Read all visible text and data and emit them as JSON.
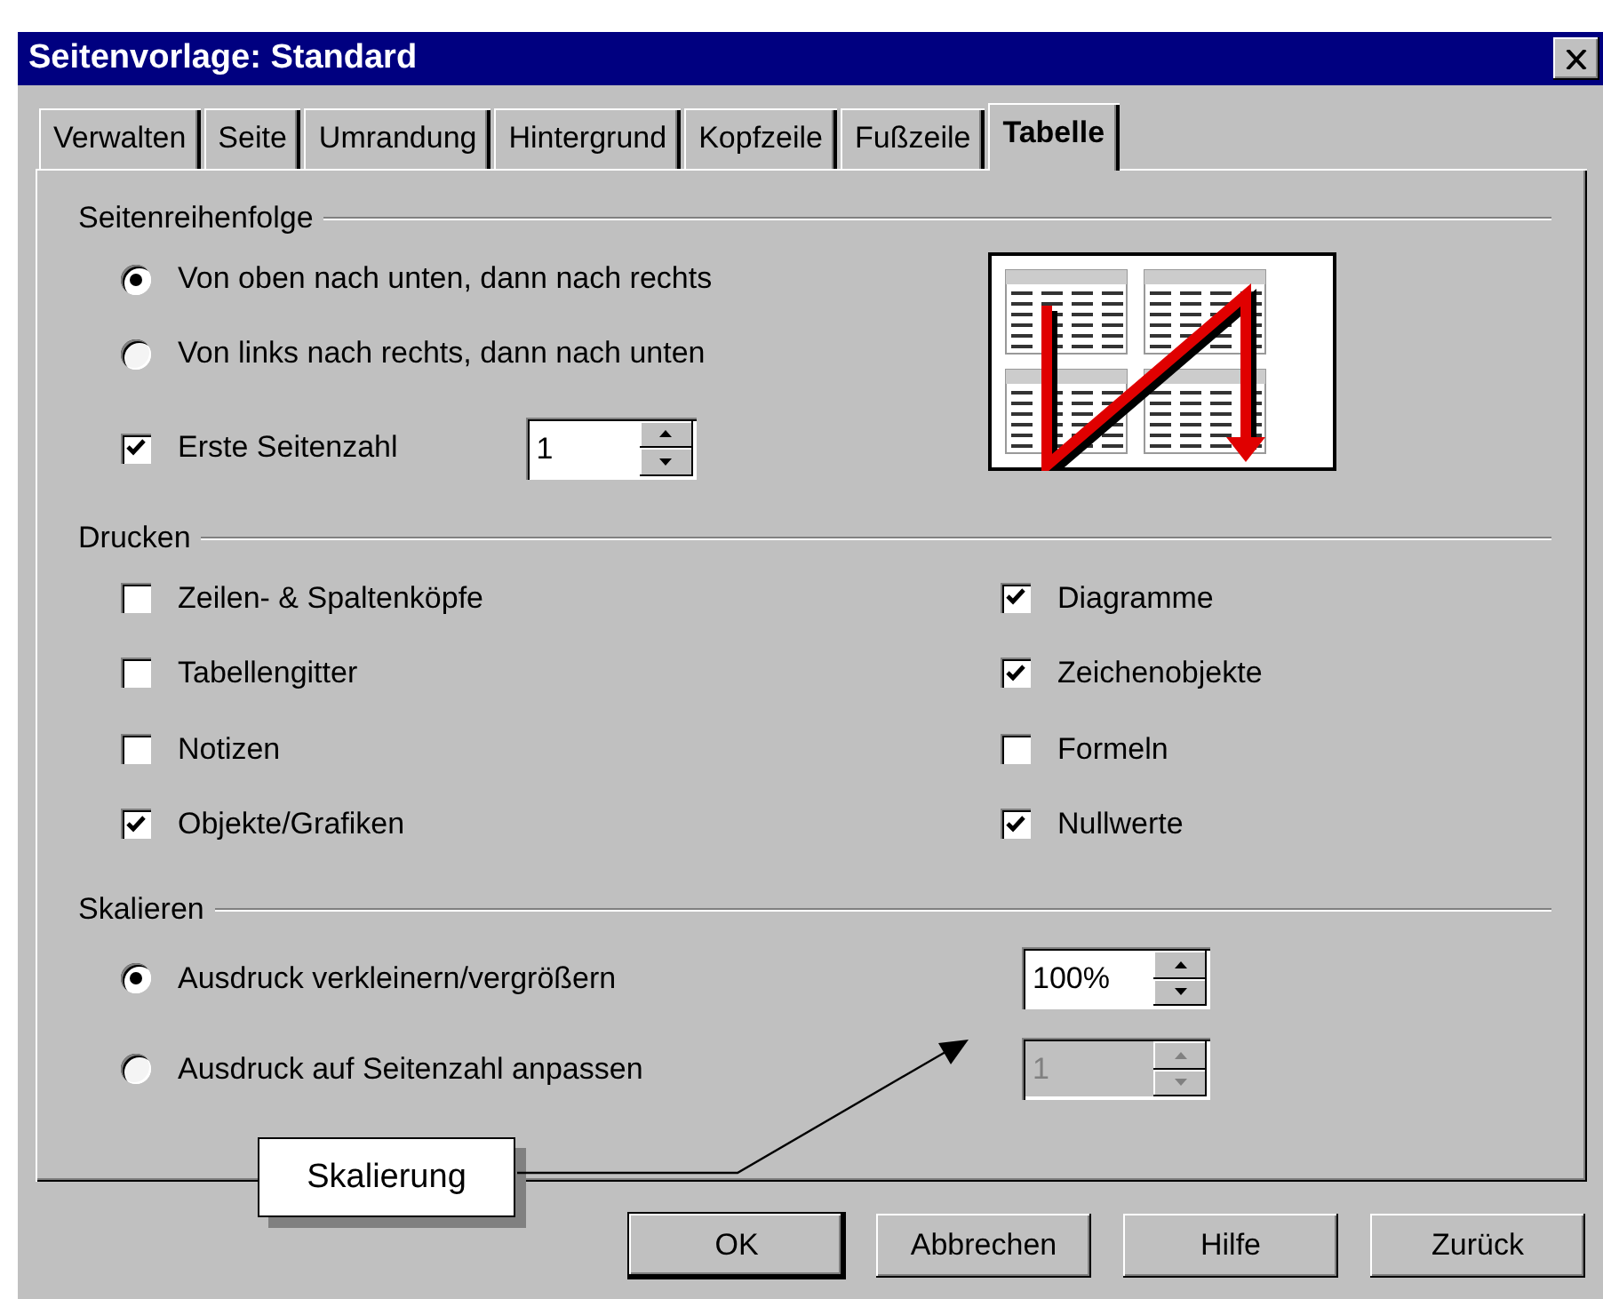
{
  "window": {
    "title": "Seitenvorlage: Standard"
  },
  "tabs": [
    {
      "label": "Verwalten",
      "selected": false
    },
    {
      "label": "Seite",
      "selected": false
    },
    {
      "label": "Umrandung",
      "selected": false
    },
    {
      "label": "Hintergrund",
      "selected": false
    },
    {
      "label": "Kopfzeile",
      "selected": false
    },
    {
      "label": "Fußzeile",
      "selected": false
    },
    {
      "label": "Tabelle",
      "selected": true
    }
  ],
  "page_order": {
    "title": "Seitenreihenfolge",
    "options": [
      {
        "label": "Von oben nach unten, dann nach rechts",
        "selected": true
      },
      {
        "label": "Von links nach rechts, dann nach unten",
        "selected": false
      }
    ],
    "first_page_number": {
      "label": "Erste Seitenzahl",
      "checked": true,
      "value": "1"
    }
  },
  "print": {
    "title": "Drucken",
    "items": [
      {
        "label": "Zeilen- & Spaltenköpfe",
        "checked": false
      },
      {
        "label": "Diagramme",
        "checked": true
      },
      {
        "label": "Tabellengitter",
        "checked": false
      },
      {
        "label": "Zeichenobjekte",
        "checked": true
      },
      {
        "label": "Notizen",
        "checked": false
      },
      {
        "label": "Formeln",
        "checked": false
      },
      {
        "label": "Objekte/Grafiken",
        "checked": true
      },
      {
        "label": "Nullwerte",
        "checked": true
      }
    ]
  },
  "scaling": {
    "title": "Skalieren",
    "options": [
      {
        "label": "Ausdruck verkleinern/vergrößern",
        "selected": true,
        "value": "100%",
        "disabled": false
      },
      {
        "label": "Ausdruck auf Seitenzahl anpassen",
        "selected": false,
        "value": "1",
        "disabled": true
      }
    ]
  },
  "callout": {
    "text": "Skalierung"
  },
  "buttons": [
    {
      "label": "OK",
      "default": true
    },
    {
      "label": "Abbrechen",
      "default": false
    },
    {
      "label": "Hilfe",
      "default": false
    },
    {
      "label": "Zurück",
      "default": false
    }
  ]
}
